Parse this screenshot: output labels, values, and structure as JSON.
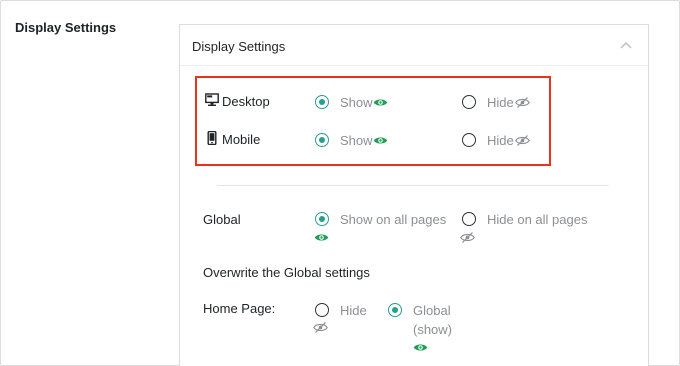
{
  "section": {
    "label": "Display Settings"
  },
  "panel": {
    "title": "Display Settings",
    "collapse_icon": "chevron-up-icon"
  },
  "devices": [
    {
      "label": "Desktop",
      "icon": "desktop-icon",
      "show_label": "Show",
      "hide_label": "Hide",
      "selected": "show"
    },
    {
      "label": "Mobile",
      "icon": "mobile-icon",
      "show_label": "Show",
      "hide_label": "Hide",
      "selected": "show"
    }
  ],
  "global": {
    "label": "Global",
    "show_label": "Show on all pages",
    "hide_label": "Hide on all pages",
    "selected": "show"
  },
  "overwrite": {
    "heading": "Overwrite the Global settings",
    "home_page": {
      "label": "Home Page:",
      "hide_label": "Hide",
      "global_label": "Global",
      "global_sub": "(show)",
      "selected": "global"
    }
  },
  "colors": {
    "accent_radio": "#2a9d8f",
    "eye_green": "#1f9d55",
    "eye_muted": "#8c8f94",
    "highlight_border": "#e8341c"
  }
}
